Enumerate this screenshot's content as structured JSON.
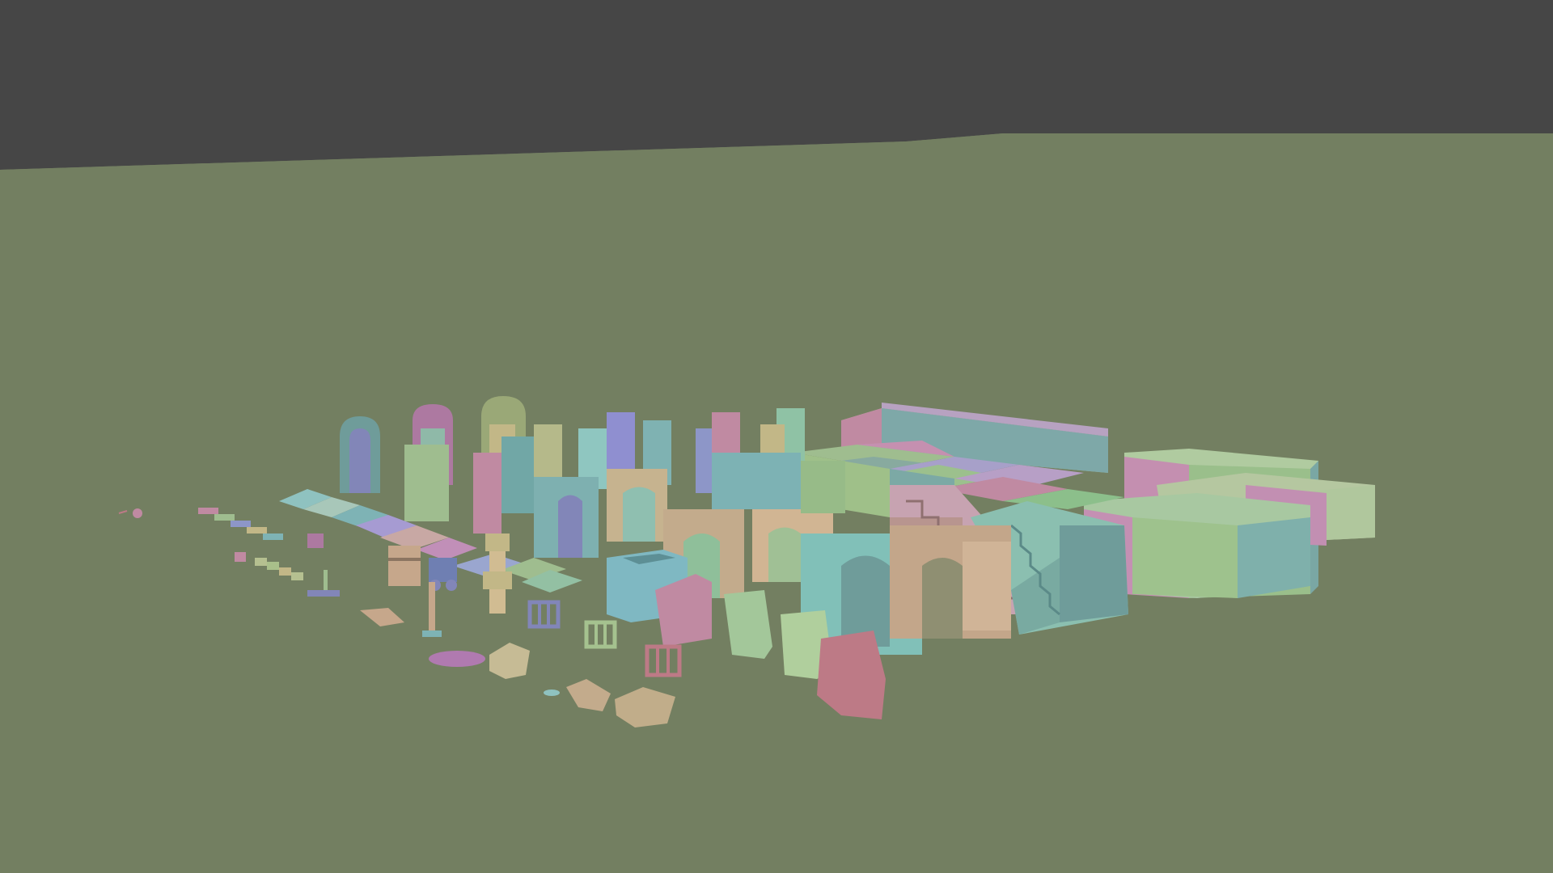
{
  "viewport": {
    "sky_color": "#464646",
    "ground_color": "#737f61",
    "palette": {
      "teal": "#6f9c9a",
      "cyan": "#71a7a6",
      "pink": "#c08aa2",
      "mauve": "#ad79a1",
      "lavender": "#8286b8",
      "periwinkle": "#8d96c8",
      "sage": "#94b384",
      "moss": "#a8be95",
      "tan": "#c3ab8c",
      "khaki": "#c2b787",
      "rose": "#bd7a86"
    }
  },
  "scene": {
    "object_groups": [
      {
        "name": "arch-doorways",
        "count": 5
      },
      {
        "name": "brick-walls",
        "count": 18
      },
      {
        "name": "floor-tiles",
        "count": 12
      },
      {
        "name": "props",
        "count": 20
      },
      {
        "name": "rocks",
        "count": 4
      },
      {
        "name": "staircases",
        "count": 2
      },
      {
        "name": "room-enclosures",
        "count": 3
      }
    ]
  }
}
